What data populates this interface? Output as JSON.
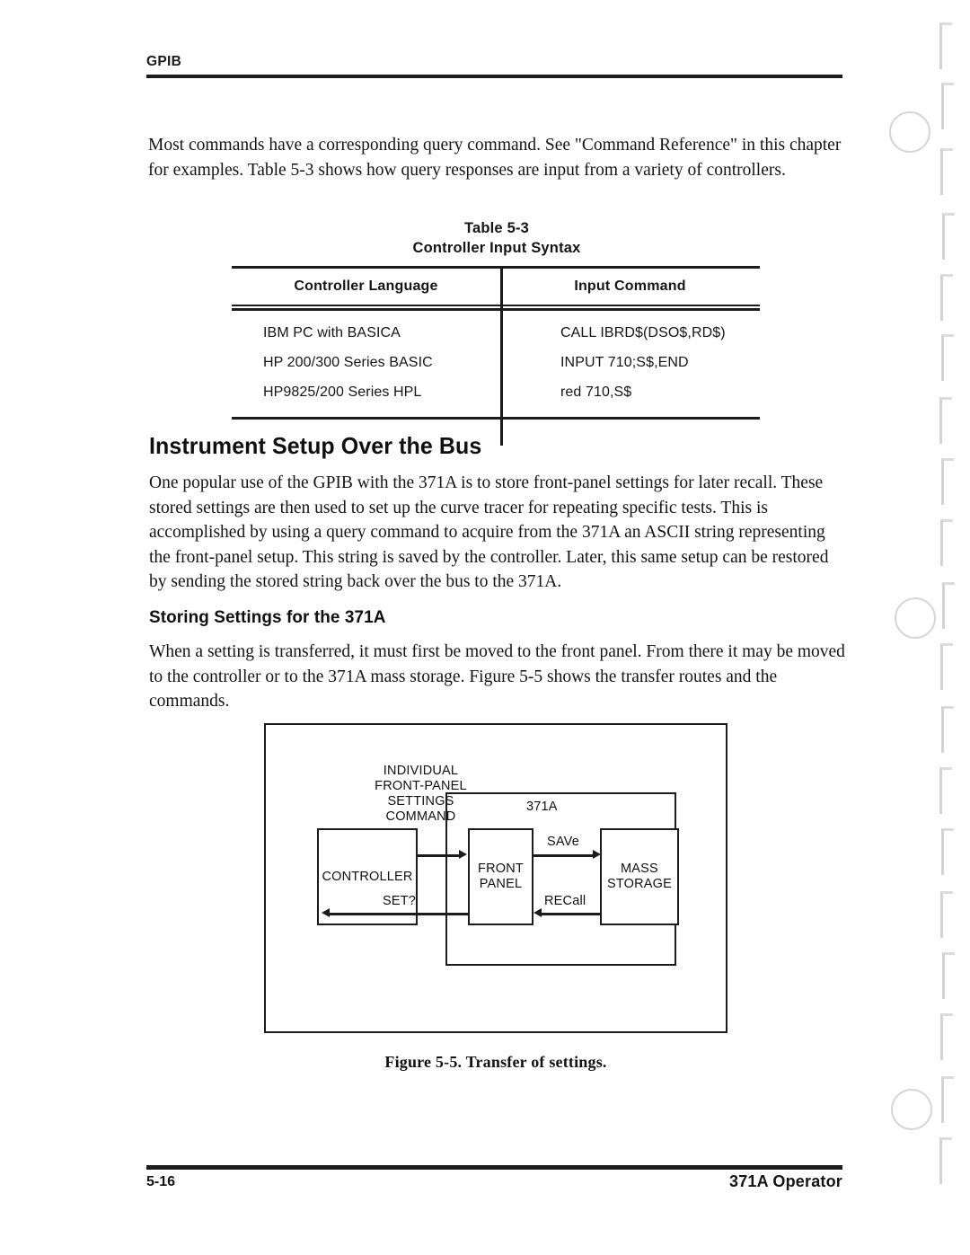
{
  "running_head": {
    "text": "GPIB"
  },
  "intro_paragraph": "Most commands have a corresponding query command.  See \"Command Reference\" in this chapter for examples.  Table 5-3 shows how query responses are input from a variety of controllers.",
  "table": {
    "number": "Table 5-3",
    "title": "Controller Input Syntax",
    "headers": [
      "Controller Language",
      "Input Command"
    ],
    "rows": [
      [
        "IBM PC with BASICA",
        "CALL IBRD$(DSO$,RD$)"
      ],
      [
        "HP 200/300 Series BASIC",
        "INPUT 710;S$,END"
      ],
      [
        "HP9825/200 Series HPL",
        "red 710,S$"
      ]
    ]
  },
  "section": {
    "heading": "Instrument Setup Over the Bus",
    "paragraph": "One popular use of the GPIB with the 371A is to store front-panel settings for later recall.  These stored settings are then used to set up the curve tracer for repeating specific tests.  This is accomplished by using a query command to acquire from the 371A an ASCII string representing the front-panel setup.  This string is saved by the controller.  Later, this same setup can be restored by sending the stored string back over the bus to the 371A."
  },
  "subsection": {
    "heading": "Storing Settings for the 371A",
    "paragraph": "When a setting is transferred, it must first be moved to the front panel.  From there it may be moved to the controller or to the 371A mass storage.  Figure 5-5 shows the transfer routes and the commands."
  },
  "figure": {
    "caption": "Figure 5-5.  Transfer of settings.",
    "diagram": {
      "enclosure_label": "371A",
      "command_label": "INDIVIDUAL\nFRONT-PANEL\nSETTINGS\nCOMMAND",
      "nodes": {
        "controller": "CONTROLLER",
        "front_panel": "FRONT\nPANEL",
        "mass_storage": "MASS\nSTORAGE"
      },
      "edges": {
        "controller_to_front_panel": "",
        "front_panel_to_controller": "SET?",
        "front_panel_to_mass_storage": "SAVe",
        "mass_storage_to_front_panel": "RECall"
      }
    }
  },
  "footer": {
    "page_number": "5-16",
    "document_title": "371A Operator"
  }
}
